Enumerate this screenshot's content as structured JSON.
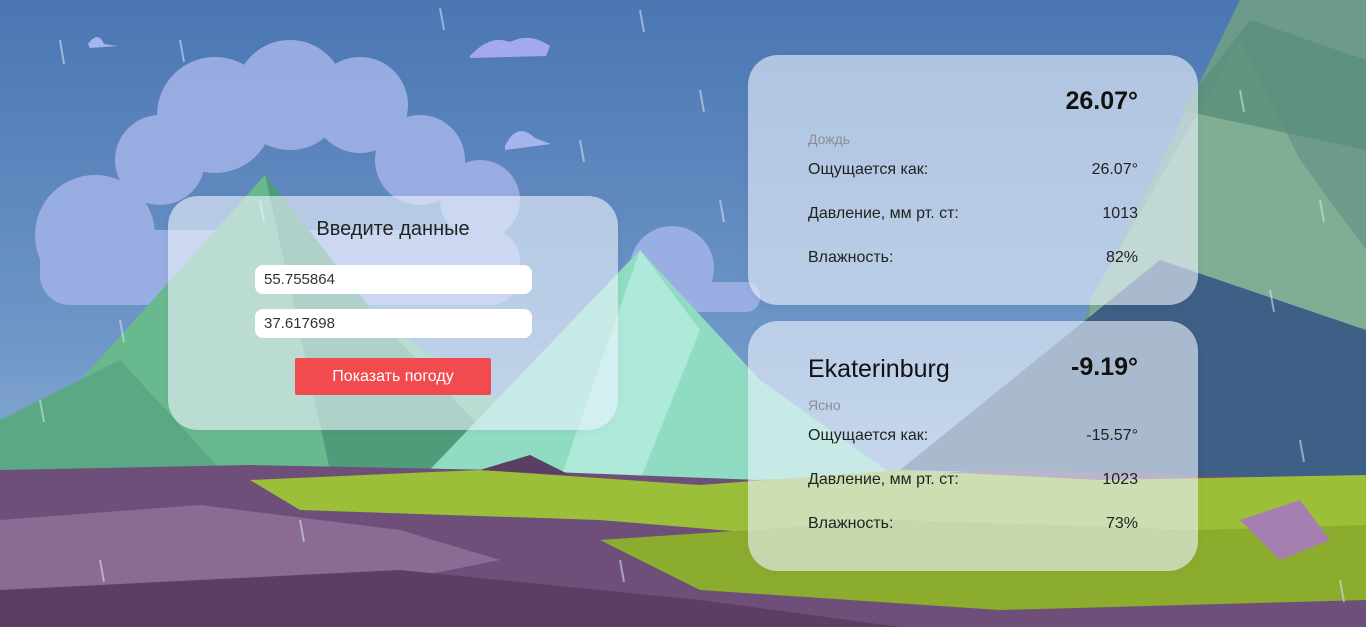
{
  "form": {
    "title": "Введите данные",
    "latitude_value": "55.755864",
    "longitude_value": "37.617698",
    "submit_label": "Показать погоду"
  },
  "weather_cards": [
    {
      "city": "",
      "temperature": "26.07°",
      "condition": "Дождь",
      "feels_like_label": "Ощущается как:",
      "feels_like_value": "26.07°",
      "pressure_label": "Давление, мм рт. ст:",
      "pressure_value": "1013",
      "humidity_label": "Влажность:",
      "humidity_value": "82%"
    },
    {
      "city": "Ekaterinburg",
      "temperature": "-9.19°",
      "condition": "Ясно",
      "feels_like_label": "Ощущается как:",
      "feels_like_value": "-15.57°",
      "pressure_label": "Давление, мм рт. ст:",
      "pressure_value": "1023",
      "humidity_label": "Влажность:",
      "humidity_value": "73%"
    }
  ],
  "colors": {
    "accent_button": "#f24b4f",
    "card_glass": "rgba(236,242,252,0.62)",
    "sky": "#4f7db8"
  }
}
